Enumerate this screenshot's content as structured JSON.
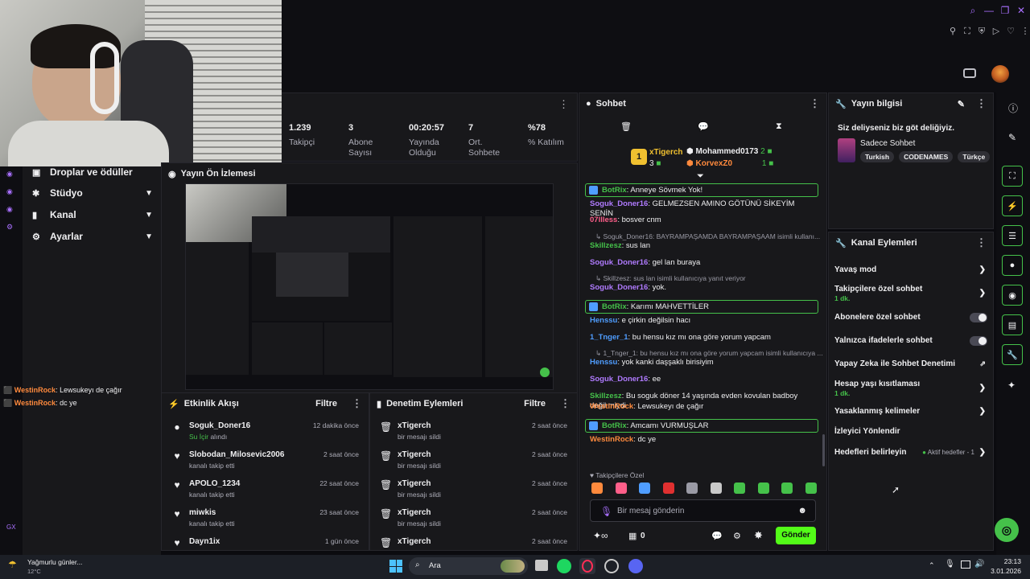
{
  "topbar": {
    "window_icons": [
      "search-icon",
      "minimize-icon",
      "restore-icon",
      "close-icon"
    ]
  },
  "stats": [
    {
      "value": "1.239",
      "label": "Takipçi"
    },
    {
      "value": "3",
      "label": "Abone Sayısı"
    },
    {
      "value": "00:20:57",
      "label": "Yayında Olduğu"
    },
    {
      "value": "7",
      "label": "Ort. Sohbete"
    },
    {
      "value": "%78",
      "label": "% Katılım"
    }
  ],
  "nav": {
    "drops": "Droplar ve ödüller",
    "studio": "Stüdyo",
    "channel": "Kanal",
    "settings": "Ayarlar"
  },
  "preview": {
    "title": "Yayın Ön İzlemesi"
  },
  "left_chat": [
    {
      "user": "WestinRock",
      "text": ": Lewsukeyı de çağır"
    },
    {
      "user": "WestinRock",
      "text": ": dc ye"
    }
  ],
  "activity": {
    "title": "Etkinlik Akışı",
    "filter": "Filtre",
    "rows": [
      {
        "name": "Soguk_Doner16",
        "sub_hl": "Su İçir",
        "sub": " alındı",
        "time": "12 dakika önce"
      },
      {
        "name": "Slobodan_Milosevic2006",
        "sub": "kanalı takip etti",
        "time": "2 saat önce"
      },
      {
        "name": "APOLO_1234",
        "sub": "kanalı takip etti",
        "time": "22 saat önce"
      },
      {
        "name": "miwkis",
        "sub": "kanalı takip etti",
        "time": "23 saat önce"
      },
      {
        "name": "Dayn1ix",
        "sub": "",
        "time": "1 gün önce"
      }
    ]
  },
  "moderation": {
    "title": "Denetim Eylemleri",
    "filter": "Filtre",
    "rows": [
      {
        "name": "xTigerch",
        "sub": "bir mesajı sildi",
        "time": "2 saat önce"
      },
      {
        "name": "xTigerch",
        "sub": "bir mesajı sildi",
        "time": "2 saat önce"
      },
      {
        "name": "xTigerch",
        "sub": "bir mesajı sildi",
        "time": "2 saat önce"
      },
      {
        "name": "xTigerch",
        "sub": "bir mesajı sildi",
        "time": "2 saat önce"
      },
      {
        "name": "xTigerch",
        "sub": "",
        "time": "2 saat önce"
      }
    ]
  },
  "chat": {
    "title": "Sohbet",
    "leaders": {
      "first": "xTigerch",
      "first_count": "3",
      "second": "Mohammed0173",
      "second_count": "2",
      "third": "KorvexZ0",
      "third_count": "1"
    },
    "lines": [
      {
        "type": "bot",
        "user": "BotRix",
        "text": ": Anneye Sövmek Yok!"
      },
      {
        "type": "msg",
        "user": "Soguk_Doner16",
        "color": "#b07bff",
        "text": ": GELMEZSEN AMINO GÖTÜNÜ SİKEYİM SENİN"
      },
      {
        "type": "msg",
        "user": "07llless",
        "color": "#ff5f8a",
        "text": ": bosver cnm"
      },
      {
        "type": "reply",
        "text": "Soguk_Doner16: BAYRAMPAŞAMDA BAYRAMPAŞAAM isimli kullanı..."
      },
      {
        "type": "msg",
        "user": "Skillzesz",
        "color": "#45c14a",
        "text": ": sus lan"
      },
      {
        "type": "msg",
        "user": "Soguk_Doner16",
        "color": "#b07bff",
        "text": ": gel lan buraya"
      },
      {
        "type": "reply",
        "text": "Skillzesz: sus lan isimli kullanıcıya yanıt veriyor"
      },
      {
        "type": "msg",
        "user": "Soguk_Doner16",
        "color": "#b07bff",
        "text": ": yok."
      },
      {
        "type": "bot",
        "user": "BotRix",
        "text": ": Karımı MAHVETTİLER"
      },
      {
        "type": "msg",
        "user": "Henssu",
        "color": "#4f9dff",
        "text": ": e çirkin değilsin hacı"
      },
      {
        "type": "msg",
        "user": "1_Tnger_1",
        "color": "#4f9dff",
        "text": ": bu hensu kız mı ona göre yorum yapcam"
      },
      {
        "type": "reply",
        "text": "1_Tnger_1: bu hensu kız mı ona göre yorum yapcam isimli kullanıcıya ..."
      },
      {
        "type": "msg",
        "user": "Henssu",
        "color": "#4f9dff",
        "text": ": yok kanki daşşaklı birisiyim"
      },
      {
        "type": "msg",
        "user": "Soguk_Doner16",
        "color": "#b07bff",
        "text": ": ee"
      },
      {
        "type": "msg2",
        "user": "Skillzesz",
        "color": "#45c14a",
        "text": ": Bu soguk döner 14 yaşında evden kovulan badboy",
        "text2": "değil miydi"
      },
      {
        "type": "msg",
        "user": "WestinRock",
        "color": "#ff8a3d",
        "text": ": Lewsukeyı de çağır"
      },
      {
        "type": "bot",
        "user": "BotRix",
        "text": ": Amcamı VURMUŞLAR"
      },
      {
        "type": "msg",
        "user": "WestinRock",
        "color": "#ff8a3d",
        "text": ": dc ye"
      }
    ],
    "followers_only": "Takipçilere Özel",
    "input_placeholder": "Bir mesaj gönderin",
    "gift_count": "0",
    "send": "Gönder"
  },
  "stream_info": {
    "title": "Yayın bilgisi",
    "stream_title": "Siz deliyseniz biz göt deliğiyiz.",
    "category": "Sadece Sohbet",
    "tags": [
      "Turkish",
      "CODENAMES",
      "Türkçe"
    ]
  },
  "channel_actions": {
    "title": "Kanal Eylemleri",
    "items": [
      {
        "label": "Yavaş mod",
        "sub": ""
      },
      {
        "label": "Takipçilere özel sohbet",
        "sub": "1 dk."
      },
      {
        "label": "Abonelere özel sohbet",
        "sub": ""
      },
      {
        "label": "Yalnızca ifadelerle sohbet",
        "sub": ""
      },
      {
        "label": "Yapay Zeka ile Sohbet Denetimi",
        "sub": ""
      },
      {
        "label": "Hesap yaşı kısıtlaması",
        "sub": "1 dk."
      },
      {
        "label": "Yasaklanmış kelimeler",
        "sub": ""
      },
      {
        "label": "İzleyici Yönlendir",
        "sub": ""
      },
      {
        "label": "Hedefleri belirleyin",
        "sub": ""
      }
    ],
    "goal_badge": "Aktif hedefler - 1"
  },
  "taskbar": {
    "weather": "Yağmurlu günler...",
    "temp": "12°C",
    "search": "Ara",
    "time": "23:13",
    "date": "3.01.2026"
  },
  "colors": {
    "accent": "#45c14a",
    "panel": "#18181b",
    "bg": "#0b0b0f"
  }
}
